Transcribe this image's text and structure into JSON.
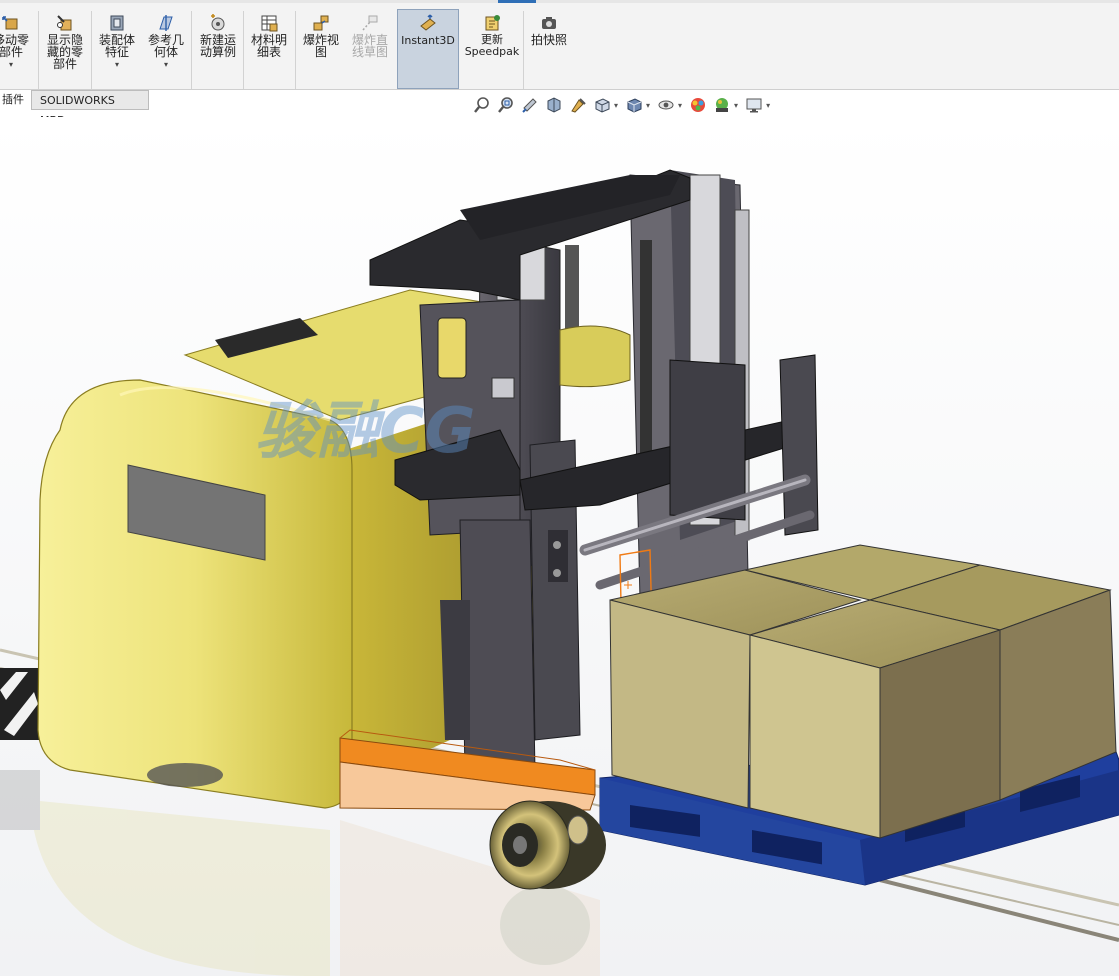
{
  "ribbon": {
    "items": [
      {
        "label": "移动零\n部件",
        "icon": "move-component-icon",
        "dropdown": true
      },
      {
        "label": "显示隐\n藏的零\n部件",
        "icon": "show-hidden-icon",
        "dropdown": false
      },
      {
        "label": "装配体\n特征",
        "icon": "assembly-features-icon",
        "dropdown": true
      },
      {
        "label": "参考几\n何体",
        "icon": "reference-geometry-icon",
        "dropdown": true
      },
      {
        "label": "新建运\n动算例",
        "icon": "motion-study-icon",
        "dropdown": false
      },
      {
        "label": "材料明\n细表",
        "icon": "bill-of-materials-icon",
        "dropdown": false
      },
      {
        "label": "爆炸视\n图",
        "icon": "exploded-view-icon",
        "dropdown": false
      },
      {
        "label": "爆炸直\n线草图",
        "icon": "explode-line-sketch-icon",
        "dropdown": false,
        "disabled": true
      },
      {
        "label": "Instant3D",
        "icon": "instant3d-icon",
        "dropdown": false,
        "active": true
      },
      {
        "label": "更新\nSpeedpak",
        "icon": "update-speedpak-icon",
        "dropdown": false
      },
      {
        "label": "拍快照",
        "icon": "snapshot-camera-icon",
        "dropdown": false
      }
    ]
  },
  "tabs": [
    {
      "label": "插件",
      "selected": false
    },
    {
      "label": "SOLIDWORKS MBD",
      "selected": true
    }
  ],
  "view_toolbar": {
    "icons": [
      "zoom-to-fit-icon",
      "zoom-to-area-icon",
      "previous-view-icon",
      "section-view-icon",
      "dynamic-annotation-icon",
      "view-orientation-icon",
      "display-style-icon",
      "hide-show-items-icon",
      "edit-appearance-icon",
      "apply-scene-icon",
      "view-settings-icon"
    ]
  },
  "viewport": {
    "watermark": "骏融CG",
    "background": "#ffffff",
    "model": "autonomous forklift with loaded pallet"
  },
  "colors": {
    "body_yellow": "#e6db5a",
    "mast_gray": "#5c5a60",
    "pallet_blue": "#1f3f9e",
    "box_tan": "#c9bd8a",
    "selection_orange": "#f07a14",
    "accent_blue": "#2f6fb7"
  }
}
